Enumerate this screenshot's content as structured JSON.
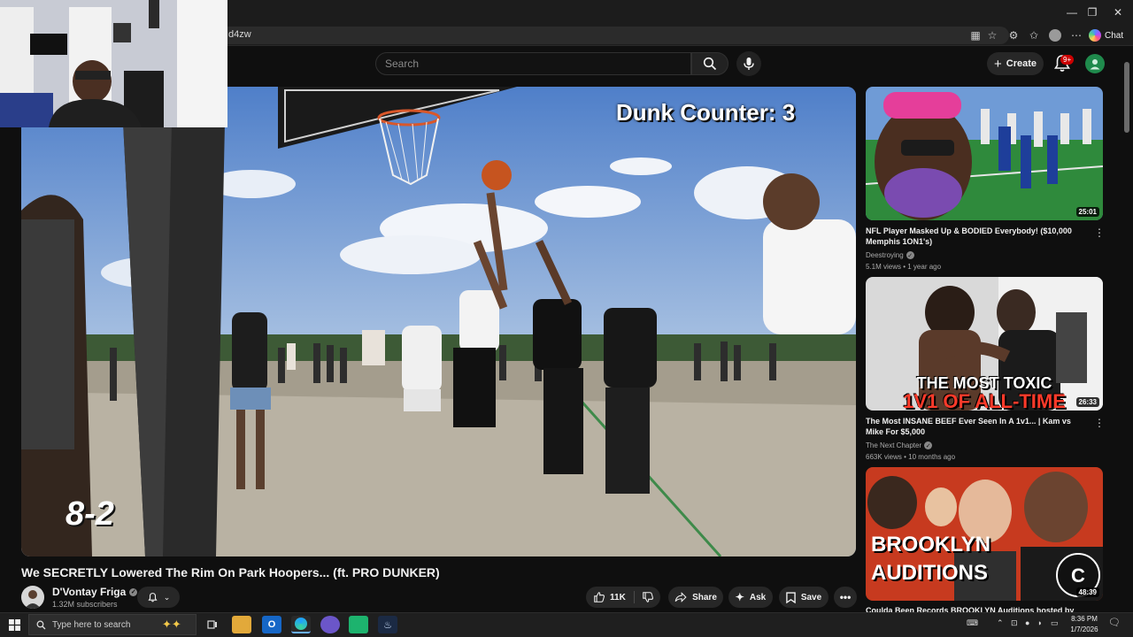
{
  "browser": {
    "url_fragment": "d4zw",
    "chat_label": "Chat",
    "window_controls": [
      "minimize-icon",
      "restore-icon",
      "close-icon"
    ]
  },
  "youtube_header": {
    "search_placeholder": "Search",
    "create_label": "Create",
    "notification_badge": "9+"
  },
  "player": {
    "dunk_counter": "Dunk Counter: 3",
    "score_overlay": "8-2"
  },
  "video": {
    "title": "We SECRETLY Lowered The Rim On Park Hoopers... (ft. PRO DUNKER)",
    "channel_name": "D'Vontay Friga",
    "subscribers": "1.32M subscribers",
    "like_count": "11K",
    "share_label": "Share",
    "ask_label": "Ask",
    "save_label": "Save"
  },
  "recommendations": [
    {
      "title": "NFL Player Masked Up & BODIED Everybody! ($10,000 Memphis 1ON1's)",
      "channel": "Deestroying",
      "verified": true,
      "meta": "5.1M views • 1 year ago",
      "duration": "25:01"
    },
    {
      "title": "The Most INSANE BEEF Ever Seen In A 1v1... | Kam vs Mike For $5,000",
      "channel": "The Next Chapter",
      "verified": true,
      "meta": "663K views • 10 months ago",
      "duration": "26:33",
      "thumb_text_1": "THE MOST TOXIC",
      "thumb_text_2": "1V1 OF ALL-TIME"
    },
    {
      "title": "Coulda Been Records BROOKLYN Auditions hosted by",
      "duration": "48:39",
      "thumb_text_1": "BROOKLYN",
      "thumb_text_2": "AUDITIONS"
    }
  ],
  "taskbar": {
    "search_placeholder": "Type here to search",
    "time": "8:36 PM",
    "date": "1/7/2026"
  },
  "colors": {
    "background": "#0f0f0f",
    "accent_red": "#cc0000",
    "avatar_green": "#1f8a4c"
  }
}
